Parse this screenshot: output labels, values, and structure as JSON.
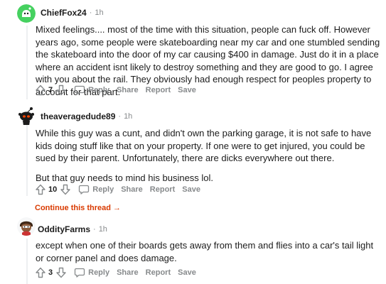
{
  "comments": [
    {
      "author": "ChiefFox24",
      "separator": "·",
      "time": "1h",
      "paragraphs": [
        "Mixed feelings.... most of the time with this situation, people can fuck off. However years ago, some people were skateboarding near my car and one stumbled sending the skateboard into the door of my car causing $400 in damage. Just do it in a place where an accident isnt likely to destroy something and they are good to go. I agree with you about the rail. They obviously had enough respect for peoples property to account for that part."
      ],
      "score": "7",
      "actions": {
        "reply": "Reply",
        "share": "Share",
        "report": "Report",
        "save": "Save"
      }
    },
    {
      "author": "theaveragedude89",
      "separator": "·",
      "time": "1h",
      "paragraphs": [
        "While this guy was a cunt, and didn't own the parking garage, it is not safe to have kids doing stuff like that on your property. If one were to get injured, you could be sued by their parent. Unfortunately, there are dicks everywhere out there.",
        "But that guy needs to mind his business lol."
      ],
      "score": "10",
      "actions": {
        "reply": "Reply",
        "share": "Share",
        "report": "Report",
        "save": "Save"
      }
    },
    {
      "author": "OddityFarms",
      "separator": "·",
      "time": "1h",
      "paragraphs": [
        "except when one of their boards gets away from them and flies into a car's tail light or corner panel and does damage."
      ],
      "score": "3",
      "actions": {
        "reply": "Reply",
        "share": "Share",
        "report": "Report",
        "save": "Save"
      }
    }
  ],
  "continue_thread": "Continue this thread →",
  "colors": {
    "text": "#1c1c1c",
    "meta": "#878a8c",
    "continue": "#d93a00",
    "thread_line": "#edeff1"
  }
}
